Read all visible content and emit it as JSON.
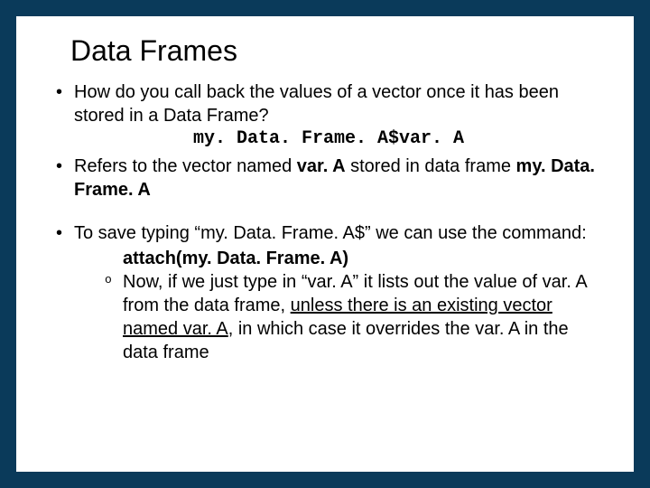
{
  "title": "Data Frames",
  "bullets": {
    "b1": "How do you call back the values of a vector once it has been stored in a Data Frame?",
    "code1": "my. Data. Frame. A$var. A",
    "b2_pre": "Refers to the vector named ",
    "b2_var": "var. A",
    "b2_mid": " stored in data frame ",
    "b2_df": "my. Data. Frame. A",
    "b3": "To save typing “my. Data. Frame. A$” we can use the command:",
    "attach": "attach(my. Data. Frame. A)",
    "sub_pre": "Now, if we just type in “var. A” it lists out the value of var. A from the data frame, ",
    "sub_u": "unless there is an existing vector named var. A",
    "sub_post": ", in which case it overrides the var. A in the data frame"
  }
}
